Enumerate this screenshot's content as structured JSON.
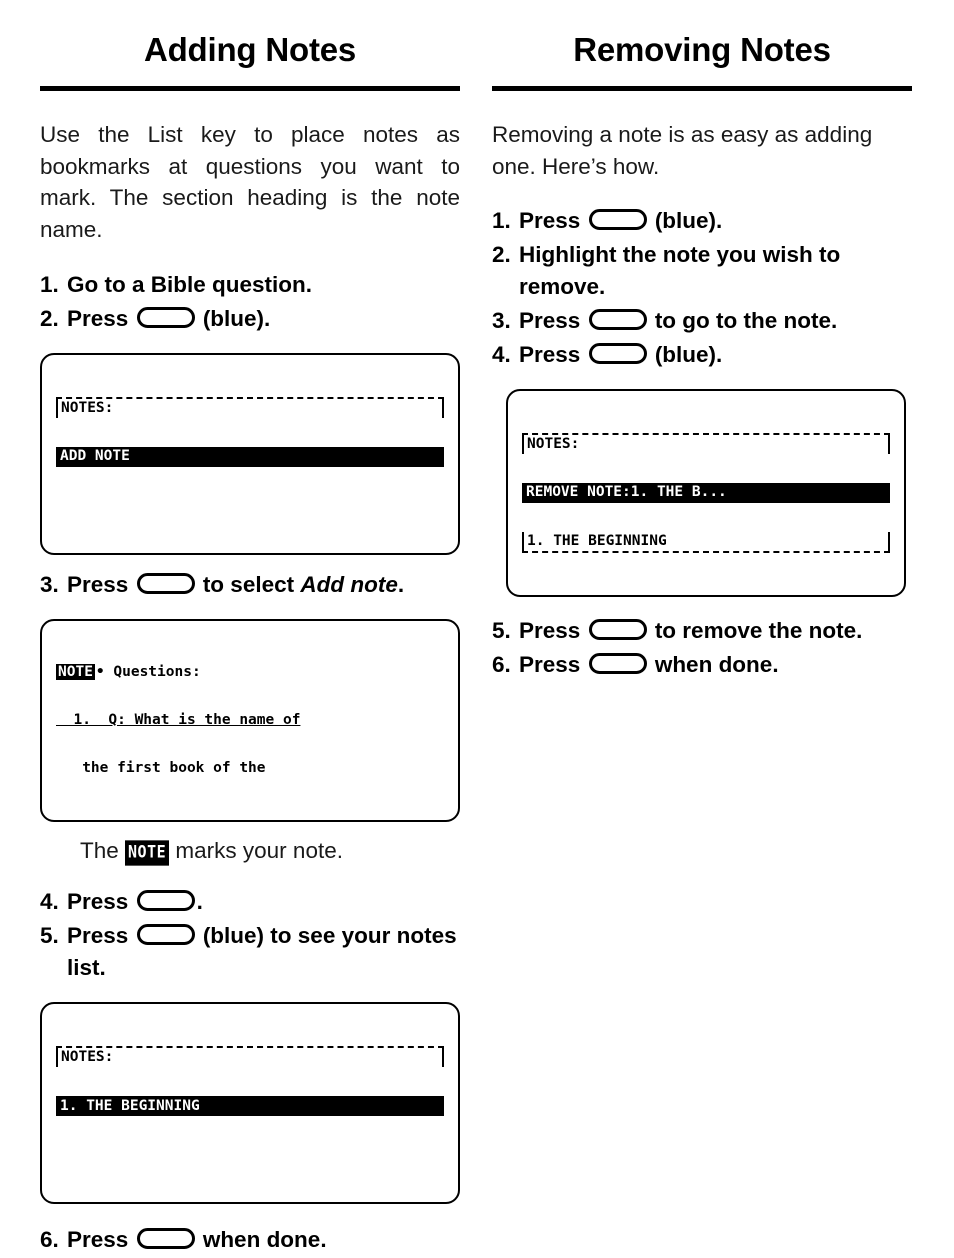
{
  "left": {
    "heading": "Adding Notes",
    "intro": "Use the List key to place notes as bookmarks at questions you want to mark. The section heading is the note name.",
    "steps": [
      {
        "num": "1.",
        "pre": "Go to a Bible question.",
        "key": false,
        "post": ""
      },
      {
        "num": "2.",
        "pre": "Press ",
        "key": true,
        "post": " (blue)."
      },
      {
        "num": "3.",
        "pre": "Press ",
        "key": true,
        "post": " to select ",
        "em": "Add note",
        "tail": "."
      },
      {
        "num": "4.",
        "pre": "Press ",
        "key": true,
        "post": "."
      },
      {
        "num": "5.",
        "pre": "Press ",
        "key": true,
        "post": " (blue) to see your notes list."
      },
      {
        "num": "6.",
        "pre": "Press ",
        "key": true,
        "post": " when done."
      }
    ],
    "note_caption_before": "The ",
    "note_caption_badge": "NOTE",
    "note_caption_after": " marks your note.",
    "screens": {
      "add_note": {
        "line1": "NOTES:",
        "line2": "ADD NOTE"
      },
      "question": {
        "badge": "NOTE",
        "line1_rest": "• Questions:",
        "line2": "  1.  Q: What is the name of",
        "line3": "   the first book of the"
      },
      "notes_list": {
        "line1": "NOTES:",
        "line2": "1. THE BEGINNING"
      }
    }
  },
  "right": {
    "heading": "Removing Notes",
    "intro": "Removing a note is as easy as adding one. Here’s how.",
    "steps": [
      {
        "num": "1.",
        "pre": "Press ",
        "key": true,
        "post": " (blue)."
      },
      {
        "num": "2.",
        "pre": "Highlight the note you wish to remove.",
        "key": false,
        "post": ""
      },
      {
        "num": "3.",
        "pre": "Press ",
        "key": true,
        "post": " to go to the note."
      },
      {
        "num": "4.",
        "pre": "Press ",
        "key": true,
        "post": " (blue)."
      },
      {
        "num": "5.",
        "pre": "Press ",
        "key": true,
        "post": " to remove the note."
      },
      {
        "num": "6.",
        "pre": "Press ",
        "key": true,
        "post": " when done."
      }
    ],
    "screens": {
      "remove_note": {
        "line1": "NOTES:",
        "line2": "REMOVE NOTE:1. THE B...",
        "line3": "1. THE BEGINNING"
      }
    }
  },
  "icons": {
    "key": "rounded-key-icon"
  },
  "colors": {
    "ink": "#000000",
    "paper": "#ffffff"
  }
}
